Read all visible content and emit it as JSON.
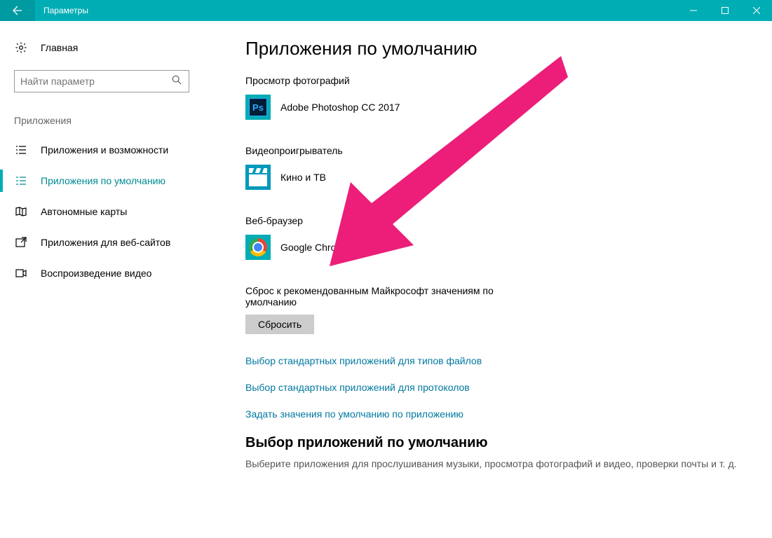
{
  "titlebar": {
    "title": "Параметры"
  },
  "sidebar": {
    "home": "Главная",
    "search_placeholder": "Найти параметр",
    "section": "Приложения",
    "items": [
      {
        "label": "Приложения и возможности"
      },
      {
        "label": "Приложения по умолчанию"
      },
      {
        "label": "Автономные карты"
      },
      {
        "label": "Приложения для веб-сайтов"
      },
      {
        "label": "Воспроизведение видео"
      }
    ]
  },
  "main": {
    "heading": "Приложения по умолчанию",
    "groups": {
      "photo": {
        "label": "Просмотр фотографий",
        "app": "Adobe Photoshop CC 2017"
      },
      "video": {
        "label": "Видеопроигрыватель",
        "app": "Кино и ТВ"
      },
      "browser": {
        "label": "Веб-браузер",
        "app": "Google Chrome"
      }
    },
    "reset": {
      "label": "Сброс к рекомендованным Майкрософт значениям по умолчанию",
      "button": "Сбросить"
    },
    "links": [
      "Выбор стандартных приложений для типов файлов",
      "Выбор стандартных приложений для протоколов",
      "Задать значения по умолчанию по приложению"
    ],
    "sub": {
      "heading": "Выбор приложений по умолчанию",
      "text": "Выберите приложения для прослушивания музыки, просмотра фотографий и видео, проверки почты и т. д."
    }
  },
  "annotation": {
    "color": "#ec1e79"
  }
}
